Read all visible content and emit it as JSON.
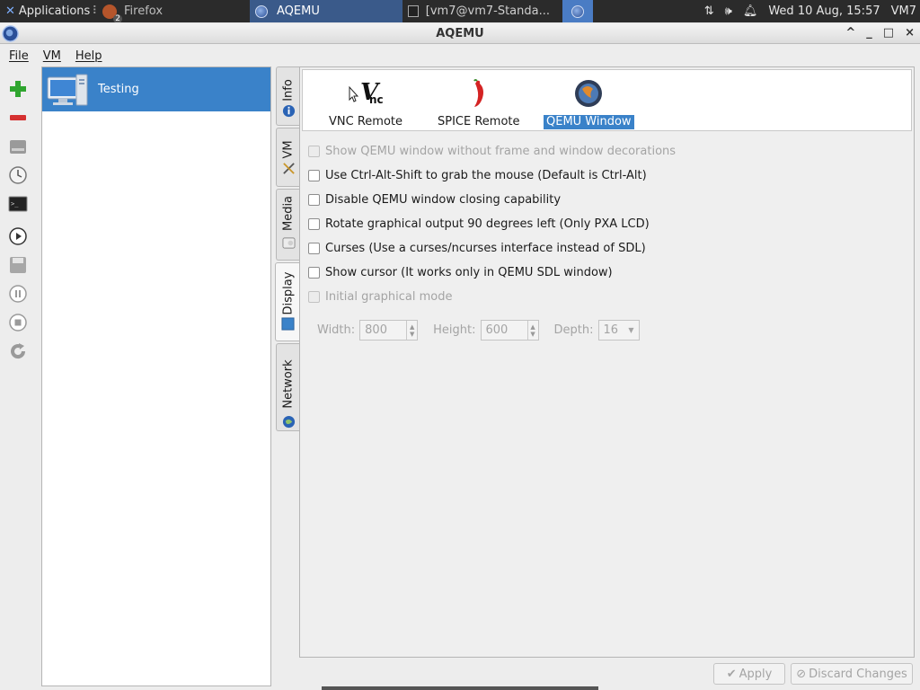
{
  "taskbar": {
    "applications_label": "Applications",
    "firefox_label": "Firefox",
    "firefox_badge": "2",
    "aqemu_label": "AQEMU",
    "terminal_label": "[vm7@vm7-Standa...",
    "datetime": "Wed 10 Aug, 15:57",
    "user": "VM7"
  },
  "window": {
    "title": "AQEMU",
    "controls": [
      "^",
      "_",
      "□",
      "×"
    ]
  },
  "menu": [
    "File",
    "VM",
    "Help"
  ],
  "toolbar_icons": [
    "add-vm-icon",
    "remove-vm-icon",
    "disk-icon",
    "clock-icon",
    "terminal-icon",
    "play-icon",
    "save-icon",
    "pause-icon",
    "stop-icon",
    "reload-icon"
  ],
  "vm_list": [
    {
      "name": "Testing",
      "selected": true
    }
  ],
  "tabs": [
    {
      "label": "Info",
      "icon": "info-icon"
    },
    {
      "label": "VM",
      "icon": "tools-icon"
    },
    {
      "label": "Media",
      "icon": "media-icon"
    },
    {
      "label": "Display",
      "icon": "display-icon",
      "active": true
    },
    {
      "label": "Network",
      "icon": "network-icon"
    }
  ],
  "display": {
    "modes": [
      {
        "label": "VNC Remote",
        "icon": "vnc-icon"
      },
      {
        "label": "SPICE Remote",
        "icon": "spice-icon"
      },
      {
        "label": "QEMU Window",
        "icon": "qemu-icon",
        "selected": true
      }
    ],
    "options": [
      {
        "label": "Show QEMU window without frame and window decorations",
        "enabled": false,
        "checked": false
      },
      {
        "label": "Use Ctrl-Alt-Shift to grab the mouse (Default is Ctrl-Alt)",
        "enabled": true,
        "checked": false
      },
      {
        "label": "Disable QEMU window closing capability",
        "enabled": true,
        "checked": false
      },
      {
        "label": "Rotate graphical output 90 degrees left (Only PXA LCD)",
        "enabled": true,
        "checked": false
      },
      {
        "label": "Curses (Use a curses/ncurses interface instead of SDL)",
        "enabled": true,
        "checked": false
      },
      {
        "label": "Show cursor (It works only in QEMU SDL window)",
        "enabled": true,
        "checked": false
      },
      {
        "label": "Initial graphical mode",
        "enabled": false,
        "checked": false
      }
    ],
    "width_label": "Width:",
    "width_value": "800",
    "height_label": "Height:",
    "height_value": "600",
    "depth_label": "Depth:",
    "depth_value": "16"
  },
  "buttons": {
    "apply": "Apply",
    "discard": "Discard Changes"
  },
  "colors": {
    "selection": "#3a82c9",
    "taskbar": "#2b2b2b"
  }
}
